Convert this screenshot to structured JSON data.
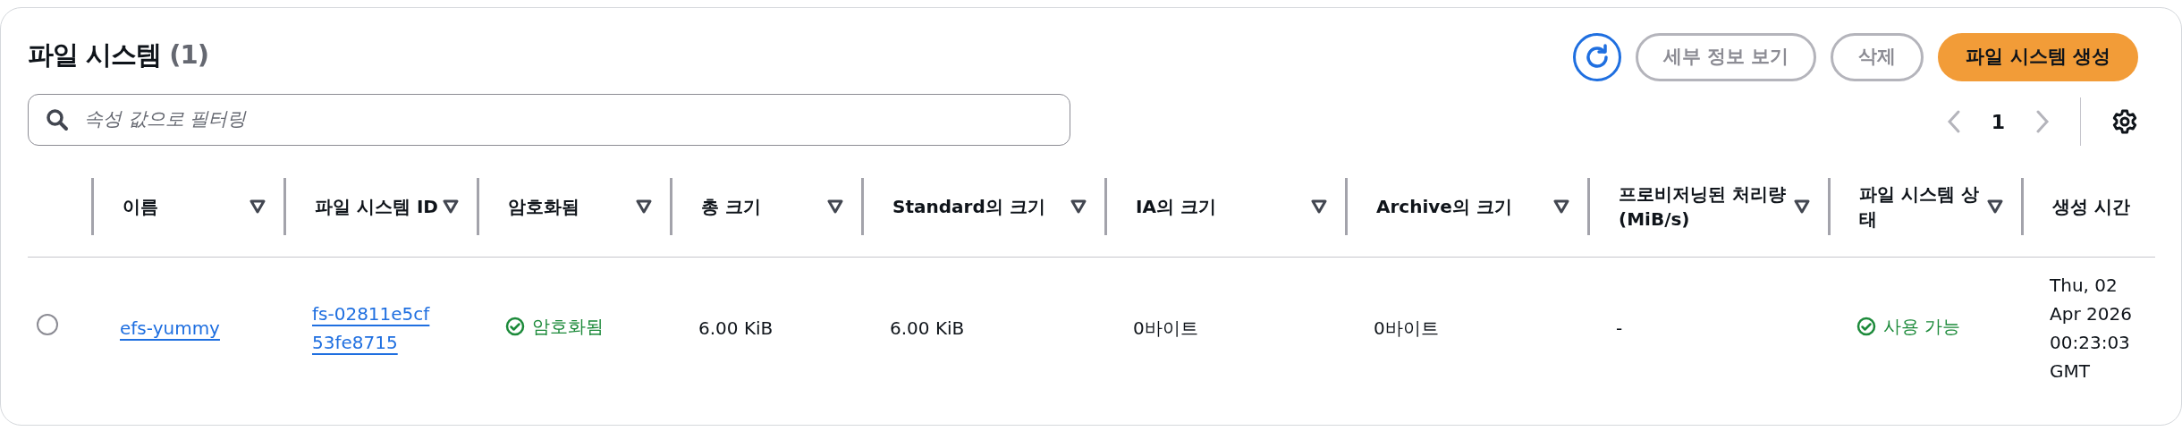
{
  "header": {
    "title": "파일 시스템",
    "count": "(1)"
  },
  "buttons": [
    {
      "label": "세부 정보 보기",
      "kind": "secondary"
    },
    {
      "label": "삭제",
      "kind": "secondary"
    },
    {
      "label": "파일 시스템 생성",
      "kind": "primary"
    }
  ],
  "filter": {
    "placeholder": "속성 값으로 필터링"
  },
  "pagination": {
    "previous_disabled": true,
    "next_disabled": true,
    "pages": [
      {
        "label": "1",
        "selected": true
      }
    ]
  },
  "table": {
    "columns": [
      {
        "label": "이름",
        "sortable": true
      },
      {
        "label": "파일 시스템 ID",
        "sortable": true
      },
      {
        "label": "암호화됨",
        "sortable": true
      },
      {
        "label": "총 크기",
        "sortable": true
      },
      {
        "label": "Standard의 크기",
        "sortable": true
      },
      {
        "label": "IA의 크기",
        "sortable": true
      },
      {
        "label": "Archive의 크기",
        "sortable": true
      },
      {
        "label": "프로비저닝된 처리량(MiB/s)",
        "sortable": true
      },
      {
        "label": "파일 시스템 상태",
        "sortable": true
      },
      {
        "label": "생성 시간",
        "sortable": false
      }
    ],
    "rows": [
      {
        "selected": false,
        "cells": [
          {
            "kind": "link",
            "text": "efs-yummy"
          },
          {
            "kind": "link",
            "text": "fs-02811e5cf53fe8715"
          },
          {
            "kind": "status",
            "text": "암호화됨"
          },
          {
            "kind": "text",
            "text": "6.00 KiB"
          },
          {
            "kind": "text",
            "text": "6.00 KiB"
          },
          {
            "kind": "text",
            "text": "0바이트"
          },
          {
            "kind": "text",
            "text": "0바이트"
          },
          {
            "kind": "text",
            "text": "-"
          },
          {
            "kind": "status",
            "text": "사용 가능"
          },
          {
            "kind": "text",
            "text": "Thu, 02 Apr 2026 00:23:03 GMT"
          }
        ]
      }
    ]
  }
}
